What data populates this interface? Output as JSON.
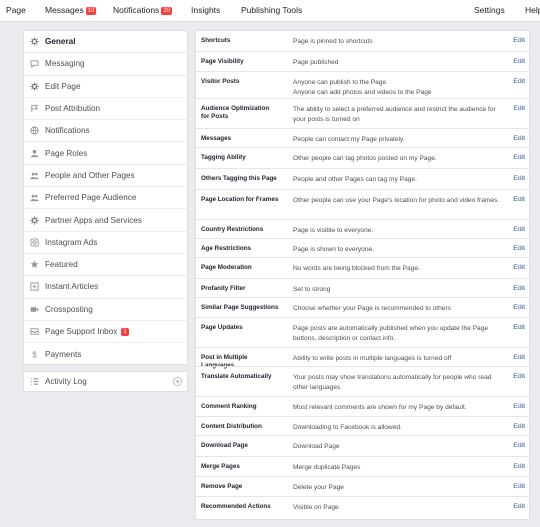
{
  "topnav": {
    "page": "Page",
    "messages": "Messages",
    "messages_badge": "10",
    "notifications": "Notifications",
    "notifications_badge": "20",
    "insights": "Insights",
    "publishing_tools": "Publishing Tools",
    "settings": "Settings",
    "help": "Help"
  },
  "sidebar": {
    "items": [
      {
        "label": "General",
        "icon": "gear-icon"
      },
      {
        "label": "Messaging",
        "icon": "message-icon"
      },
      {
        "label": "Edit Page",
        "icon": "gear-icon"
      },
      {
        "label": "Post Attribution",
        "icon": "flag-icon"
      },
      {
        "label": "Notifications",
        "icon": "globe-icon"
      },
      {
        "label": "Page Roles",
        "icon": "person-icon"
      },
      {
        "label": "People and Other Pages",
        "icon": "people-icon"
      },
      {
        "label": "Preferred Page Audience",
        "icon": "people-icon"
      },
      {
        "label": "Partner Apps and Services",
        "icon": "gear-icon"
      },
      {
        "label": "Instagram Ads",
        "icon": "instagram-icon"
      },
      {
        "label": "Featured",
        "icon": "star-icon"
      },
      {
        "label": "Instant Articles",
        "icon": "lightning-icon"
      },
      {
        "label": "Crossposting",
        "icon": "video-icon"
      },
      {
        "label": "Page Support Inbox",
        "icon": "inbox-icon",
        "badge": "1"
      },
      {
        "label": "Payments",
        "icon": "dollar-icon"
      }
    ],
    "activity_log": "Activity Log"
  },
  "settings": {
    "edit_label": "Edit",
    "rows": [
      {
        "label": "Shortcuts",
        "value": "Page is pinned to shortcuts"
      },
      {
        "label": "Page Visibility",
        "value": "Page published"
      },
      {
        "label": "Visitor Posts",
        "value": "Anyone can publish to the Page\nAnyone can add photos and videos to the Page"
      },
      {
        "label": "Audience Optimization for Posts",
        "value": "The ability to select a preferred audience and restrict the audience for your posts is turned on"
      },
      {
        "label": "Messages",
        "value": "People can contact my Page privately."
      },
      {
        "label": "Tagging Ability",
        "value": "Other people can tag photos posted on my Page."
      },
      {
        "label": "Others Tagging this Page",
        "value": "People and other Pages can tag my Page."
      },
      {
        "label": "Page Location for Frames",
        "value": "Other people can use your Page's location for photo and video frames."
      },
      {
        "label": "Country Restrictions",
        "value": "Page is visible to everyone."
      },
      {
        "label": "Age Restrictions",
        "value": "Page is shown to everyone."
      },
      {
        "label": "Page Moderation",
        "value": "No words are being blocked from the Page."
      },
      {
        "label": "Profanity Filter",
        "value": "Set to strong"
      },
      {
        "label": "Similar Page Suggestions",
        "value": "Choose whether your Page is recommended to others"
      },
      {
        "label": "Page Updates",
        "value": "Page posts are automatically published when you update the Page buttons, description or contact info."
      },
      {
        "label": "Post in Multiple Languages",
        "value": "Ability to write posts in multiple languages is turned off"
      },
      {
        "label": "Translate Automatically",
        "value": "Your posts may show translations automatically for people who read other languages"
      },
      {
        "label": "Comment Ranking",
        "value": "Most relevant comments are shown for my Page by default."
      },
      {
        "label": "Content Distribution",
        "value": "Downloading to Facebook is allowed."
      },
      {
        "label": "Download Page",
        "value": "Download Page"
      },
      {
        "label": "Merge Pages",
        "value": "Merge duplicate Pages"
      },
      {
        "label": "Remove Page",
        "value": "Delete your Page"
      },
      {
        "label": "Recommended Actions",
        "value": "Visible on Page"
      }
    ]
  }
}
